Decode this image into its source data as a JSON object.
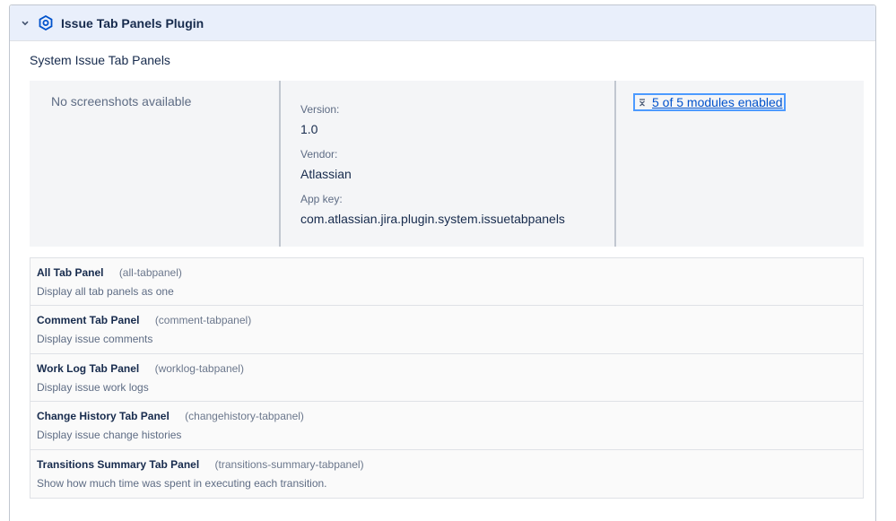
{
  "plugin": {
    "title": "Issue Tab Panels Plugin",
    "description": "System Issue Tab Panels",
    "screenshots_text": "No screenshots available",
    "version_label": "Version:",
    "version": "1.0",
    "vendor_label": "Vendor:",
    "vendor": "Atlassian",
    "app_key_label": "App key:",
    "app_key": "com.atlassian.jira.plugin.system.issuetabpanels",
    "modules_link": "5 of 5 modules enabled",
    "modules": [
      {
        "name": "All Tab Panel",
        "key": "(all-tabpanel)",
        "description": "Display all tab panels as one"
      },
      {
        "name": "Comment Tab Panel",
        "key": "(comment-tabpanel)",
        "description": "Display issue comments"
      },
      {
        "name": "Work Log Tab Panel",
        "key": "(worklog-tabpanel)",
        "description": "Display issue work logs"
      },
      {
        "name": "Change History Tab Panel",
        "key": "(changehistory-tabpanel)",
        "description": "Display issue change histories"
      },
      {
        "name": "Transitions Summary Tab Panel",
        "key": "(transitions-summary-tabpanel)",
        "description": "Show how much time was spent in executing each transition."
      }
    ]
  },
  "icons": {
    "collapse": "chevron-down-icon",
    "plugin": "hexagon-plugin-icon",
    "modules_toggle": "collapse-arrows-icon"
  },
  "colors": {
    "header_bg": "#e9effb",
    "link": "#0052cc",
    "plugin_icon": "#0052cc",
    "focus_ring": "#4c9aff"
  }
}
